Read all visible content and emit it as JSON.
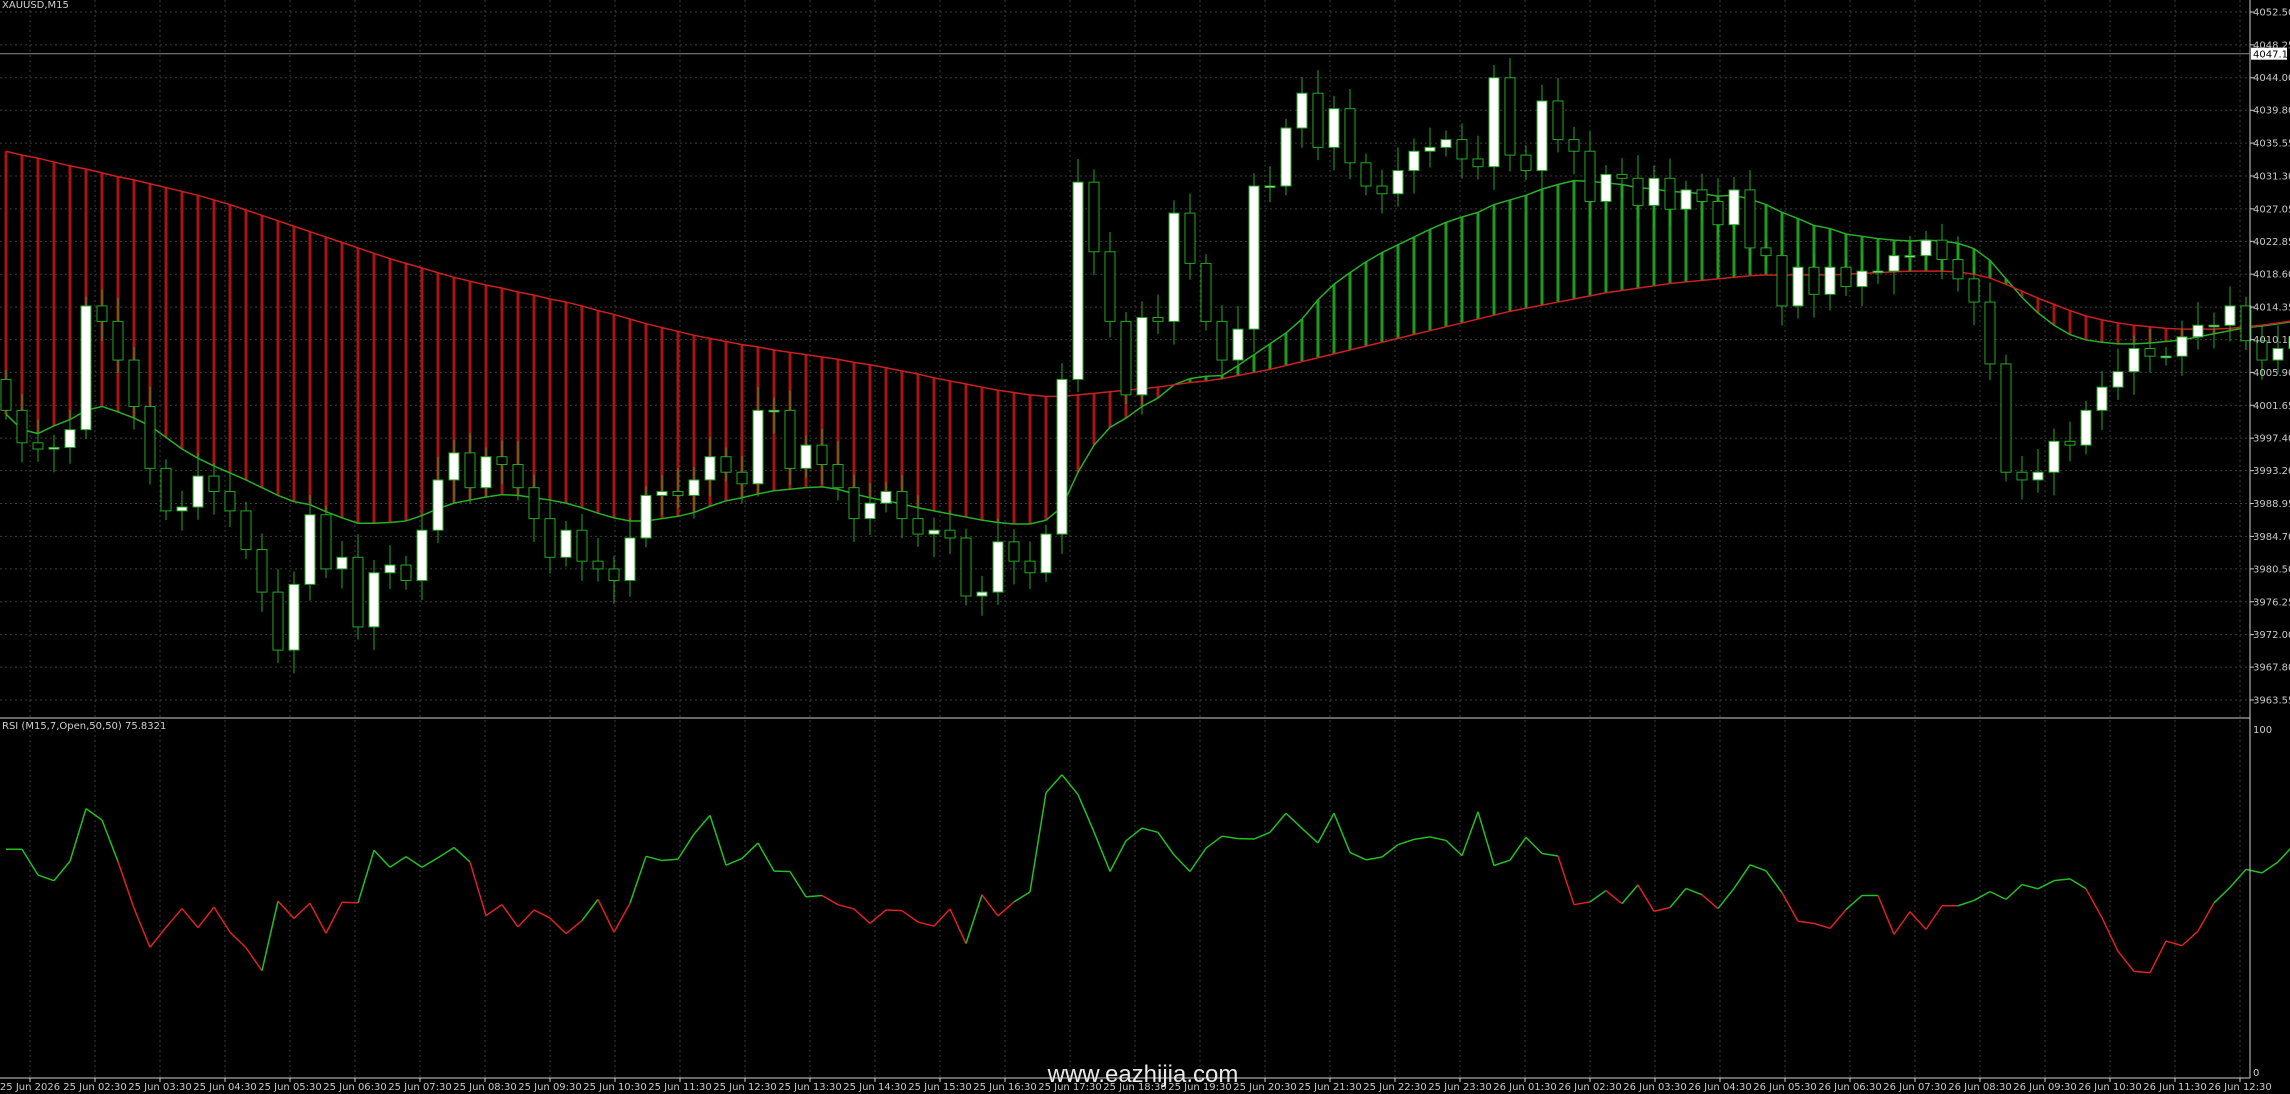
{
  "colors": {
    "background": "#000000",
    "grid": "#3c3c3c",
    "candle_bull": "#ffffff",
    "candle_bear": "#000000",
    "candle_outline": "#22aa22",
    "cloud_bull": "#1f9a1f",
    "cloud_bear": "#aa1414",
    "rsi_up": "#22c022",
    "rsi_down": "#dd2222",
    "axis_text": "#c8c8c8",
    "current_price_box": "#ffffff"
  },
  "watermark": "www.eazhijia.com",
  "chart_data": [
    {
      "type": "candlestick",
      "title": "XAUUSD,M15",
      "current_price": "4047.11",
      "ylim": [
        3963.55,
        4052.5
      ],
      "y_ticks": [
        "4052.50",
        "4048.25",
        "4044.00",
        "4039.80",
        "4035.55",
        "4031.30",
        "4027.05",
        "4022.85",
        "4018.60",
        "4014.35",
        "4010.15",
        "4005.90",
        "4001.65",
        "3997.40",
        "3993.20",
        "3988.95",
        "3984.70",
        "3980.50",
        "3976.25",
        "3972.00",
        "3967.80",
        "3963.55"
      ],
      "x_ticks": [
        "25 Jun 2026",
        "25 Jun 02:30",
        "25 Jun 03:30",
        "25 Jun 04:30",
        "25 Jun 05:30",
        "25 Jun 06:30",
        "25 Jun 07:30",
        "25 Jun 08:30",
        "25 Jun 09:30",
        "25 Jun 10:30",
        "25 Jun 11:30",
        "25 Jun 12:30",
        "25 Jun 13:30",
        "25 Jun 14:30",
        "25 Jun 15:30",
        "25 Jun 16:30",
        "25 Jun 17:30",
        "25 Jun 18:30",
        "25 Jun 19:30",
        "25 Jun 20:30",
        "25 Jun 21:30",
        "25 Jun 22:30",
        "25 Jun 23:30",
        "26 Jun 01:30",
        "26 Jun 02:30",
        "26 Jun 03:30",
        "26 Jun 04:30",
        "26 Jun 05:30",
        "26 Jun 06:30",
        "26 Jun 07:30",
        "26 Jun 08:30",
        "26 Jun 09:30",
        "26 Jun 10:30",
        "26 Jun 11:30",
        "26 Jun 12:30"
      ],
      "series": [
        {
          "kind": "close",
          "values": [
            4001.0,
            3996.8,
            3996.0,
            3996.2,
            3998.5,
            4014.5,
            4012.5,
            4007.5,
            4001.5,
            3993.5,
            3988.0,
            3988.5,
            3992.5,
            3990.5,
            3988.0,
            3983.0,
            3977.5,
            3970.0,
            3978.5,
            3987.5,
            3980.5,
            3982.0,
            3973.0,
            3980.0,
            3981.0,
            3979.0,
            3985.5,
            3992.0,
            3995.5,
            3991.0,
            3995.0,
            3994.0,
            3991.0,
            3987.0,
            3982.0,
            3985.5,
            3981.5,
            3980.5,
            3979.0,
            3984.5,
            3990.0,
            3990.5,
            3990.0,
            3992.0,
            3995.0,
            3993.0,
            3991.5,
            4001.0,
            4001.0,
            3993.5,
            3996.5,
            3994.0,
            3991.0,
            3987.0,
            3989.0,
            3990.5,
            3987.0,
            3985.0,
            3985.5,
            3984.5,
            3977.0,
            3977.5,
            3984.0,
            3981.5,
            3980.0,
            3985.0,
            4005.0,
            4030.5,
            4021.5,
            4012.5,
            4003.0,
            4013.0,
            4012.5,
            4026.5,
            4020.0,
            4012.5,
            4007.5,
            4011.5,
            4030.0,
            4030.0,
            4037.5,
            4042.0,
            4035.0,
            4040.0,
            4033.0,
            4030.0,
            4029.0,
            4032.0,
            4034.5,
            4035.0,
            4036.0,
            4033.5,
            4032.5,
            4044.0,
            4034.0,
            4032.0,
            4041.0,
            4036.0,
            4034.5,
            4028.0,
            4031.5,
            4031.0,
            4027.5,
            4031.0,
            4027.0,
            4029.5,
            4028.0,
            4025.0,
            4029.5,
            4022.0,
            4021.0,
            4014.5,
            4019.5,
            4016.0,
            4019.5,
            4017.0,
            4019.0,
            4019.0,
            4021.0,
            4021.0,
            4023.0,
            4020.5,
            4018.0,
            4015.0,
            4007.0,
            3993.0,
            3992.0,
            3993.0,
            3997.0,
            3996.5,
            4001.0,
            4004.0,
            4006.0,
            4009.0,
            4008.0,
            4008.0,
            4010.5,
            4012.0,
            4012.0,
            4014.5,
            4010.0,
            4007.5,
            4009.0,
            4010.5,
            4021.0,
            4023.0,
            4023.0,
            4031.0,
            4027.0,
            4038.0,
            4032.0,
            4030.5,
            4031.0,
            4035.5,
            4032.0,
            4030.5,
            4039.0,
            4046.5,
            4047.0
          ]
        },
        {
          "kind": "cloud_fast",
          "values": [
            4000.5,
            3998.5,
            3998.0,
            3999.0,
            3999.8,
            4001.0,
            4001.5,
            4000.8,
            4000.0,
            3999.0,
            3997.5,
            3996.0,
            3994.8,
            3993.8,
            3992.9,
            3992.0,
            3991.0,
            3990.0,
            3989.2,
            3988.8,
            3987.9,
            3987.1,
            3986.4,
            3986.4,
            3986.5,
            3986.7,
            3987.4,
            3988.3,
            3989.0,
            3989.4,
            3989.8,
            3990.1,
            3990.0,
            3989.7,
            3989.4,
            3989.0,
            3988.4,
            3987.7,
            3987.1,
            3986.7,
            3986.7,
            3987.0,
            3987.3,
            3987.8,
            3988.6,
            3989.3,
            3989.7,
            3990.2,
            3990.6,
            3990.8,
            3991.0,
            3991.1,
            3990.8,
            3990.2,
            3989.7,
            3989.3,
            3988.9,
            3988.4,
            3988.0,
            3987.6,
            3987.2,
            3986.8,
            3986.5,
            3986.3,
            3986.3,
            3986.8,
            3988.5,
            3993.0,
            3996.5,
            3998.8,
            4000.0,
            4001.5,
            4002.6,
            4004.3,
            4005.1,
            4005.4,
            4005.5,
            4006.8,
            4008.2,
            4009.6,
            4011.0,
            4012.8,
            4015.3,
            4017.3,
            4018.8,
            4020.2,
            4021.4,
            4022.4,
            4023.4,
            4024.4,
            4025.3,
            4026.0,
            4026.6,
            4027.6,
            4028.2,
            4028.8,
            4029.6,
            4030.2,
            4030.7,
            4030.6,
            4030.4,
            4030.2,
            4029.8,
            4029.6,
            4029.3,
            4029.2,
            4029.0,
            4028.7,
            4028.8,
            4028.3,
            4027.6,
            4026.6,
            4025.8,
            4024.9,
            4024.5,
            4023.8,
            4023.5,
            4023.2,
            4023.0,
            4022.9,
            4023.0,
            4022.9,
            4022.6,
            4021.9,
            4020.4,
            4018.0,
            4015.6,
            4013.6,
            4012.0,
            4010.8,
            4010.1,
            4009.8,
            4009.6,
            4009.6,
            4009.7,
            4009.9,
            4010.1,
            4010.5,
            4010.9,
            4011.3,
            4011.7,
            4011.9,
            4012.2,
            4012.5,
            4013.3,
            4014.0,
            4014.7,
            4015.6,
            4016.3,
            4017.2,
            4018.1,
            4018.9,
            4019.7,
            4020.5,
            4021.4,
            4022.4,
            4023.5,
            4024.8,
            4026.2
          ]
        },
        {
          "kind": "cloud_slow",
          "values": [
            4034.5,
            4034.0,
            4033.6,
            4033.1,
            4032.6,
            4032.2,
            4031.7,
            4031.2,
            4030.8,
            4030.3,
            4029.8,
            4029.3,
            4028.8,
            4028.2,
            4027.6,
            4026.9,
            4026.2,
            4025.5,
            4024.8,
            4024.1,
            4023.4,
            4022.7,
            4022.0,
            4021.3,
            4020.6,
            4020.0,
            4019.4,
            4018.8,
            4018.2,
            4017.7,
            4017.2,
            4016.8,
            4016.3,
            4015.9,
            4015.4,
            4015.0,
            4014.5,
            4013.9,
            4013.4,
            4012.8,
            4012.2,
            4011.7,
            4011.2,
            4010.7,
            4010.3,
            4009.9,
            4009.5,
            4009.2,
            4008.8,
            4008.5,
            4008.2,
            4007.9,
            4007.6,
            4007.2,
            4006.9,
            4006.5,
            4006.1,
            4005.7,
            4005.2,
            4004.8,
            4004.4,
            4004.0,
            4003.6,
            4003.3,
            4003.0,
            4002.8,
            4002.8,
            4003.0,
            4003.2,
            4003.4,
            4003.6,
            4003.8,
            4004.0,
            4004.3,
            4004.6,
            4004.8,
            4005.1,
            4005.5,
            4005.9,
            4006.3,
            4006.8,
            4007.3,
            4007.8,
            4008.3,
            4008.8,
            4009.3,
            4009.8,
            4010.3,
            4010.8,
            4011.3,
            4011.8,
            4012.3,
            4012.8,
            4013.3,
            4013.8,
            4014.2,
            4014.6,
            4015.0,
            4015.4,
            4015.8,
            4016.2,
            4016.5,
            4016.8,
            4017.1,
            4017.4,
            4017.6,
            4017.8,
            4018.0,
            4018.2,
            4018.4,
            4018.5,
            4018.5,
            4018.5,
            4018.5,
            4018.5,
            4018.6,
            4018.7,
            4018.8,
            4018.9,
            4019.0,
            4019.0,
            4019.0,
            4018.9,
            4018.6,
            4018.1,
            4017.3,
            4016.4,
            4015.5,
            4014.7,
            4013.9,
            4013.2,
            4012.7,
            4012.3,
            4012.0,
            4011.8,
            4011.6,
            4011.5,
            4011.5,
            4011.5,
            4011.6,
            4011.8,
            4012.0,
            4012.3,
            4012.6,
            4013.0,
            4013.5,
            4014.0,
            4014.5,
            4015.0,
            4015.5,
            4016.0,
            4016.4,
            4016.8,
            4017.2,
            4017.6,
            4018.0,
            4018.4,
            4018.8,
            4019.2
          ]
        }
      ]
    },
    {
      "type": "line",
      "title": "RSI (M15,7,Open,50,50) 75.8321",
      "ylim": [
        0,
        100
      ],
      "y_ticks": [
        "100",
        "0"
      ],
      "thresholds": [
        50,
        50
      ],
      "series": [
        {
          "name": "RSI (M15,7,Open,50,50)",
          "values": [
            64.8,
            64.8,
            57.5,
            55.9,
            61.4,
            76.3,
            73.1,
            61.3,
            48.1,
            37.0,
            42.7,
            48.0,
            42.6,
            48.4,
            41.3,
            36.9,
            30.4,
            50.1,
            45.2,
            49.5,
            41.0,
            49.8,
            49.6,
            64.5,
            59.7,
            62.7,
            59.7,
            62.4,
            65.3,
            61.2,
            46.0,
            49.1,
            42.8,
            47.6,
            45.3,
            40.9,
            44.6,
            50.6,
            41.3,
            49.5,
            62.8,
            61.6,
            62.0,
            69.1,
            74.4,
            60.3,
            62.2,
            66.6,
            58.6,
            58.5,
            51.3,
            51.7,
            49.1,
            47.9,
            43.8,
            47.6,
            47.4,
            44.2,
            43.0,
            47.9,
            38.1,
            51.9,
            45.9,
            49.9,
            52.7,
            80.8,
            85.9,
            80.3,
            69.7,
            58.5,
            67.2,
            70.8,
            69.6,
            63.2,
            58.5,
            65.1,
            68.5,
            67.8,
            67.7,
            69.6,
            75.0,
            70.7,
            66.6,
            75.0,
            63.9,
            61.8,
            62.6,
            66.1,
            67.6,
            68.3,
            67.3,
            63.0,
            75.4,
            60.2,
            61.7,
            68.2,
            63.6,
            62.9,
            49.1,
            49.9,
            53.1,
            49.4,
            54.7,
            47.2,
            48.3,
            53.7,
            51.9,
            48.0,
            53.7,
            60.4,
            58.7,
            52.5,
            44.4,
            43.8,
            42.4,
            47.7,
            51.7,
            51.7,
            40.7,
            47.1,
            42.1,
            48.8,
            48.8,
            50.3,
            52.8,
            50.6,
            54.8,
            53.6,
            55.9,
            56.4,
            53.6,
            45.4,
            35.9,
            30.2,
            29.8,
            38.8,
            37.5,
            41.6,
            49.6,
            54.0,
            59.1,
            58.1,
            61.2,
            66.1,
            70.1,
            64.8,
            58.1,
            59.7,
            56.0,
            63.0,
            71.4,
            72.5,
            77.7,
            71.0,
            76.5,
            68.0,
            68.3,
            67.8,
            69.8,
            72.1,
            73.3,
            74.9,
            66.6,
            73.3,
            75.8
          ]
        }
      ]
    }
  ]
}
